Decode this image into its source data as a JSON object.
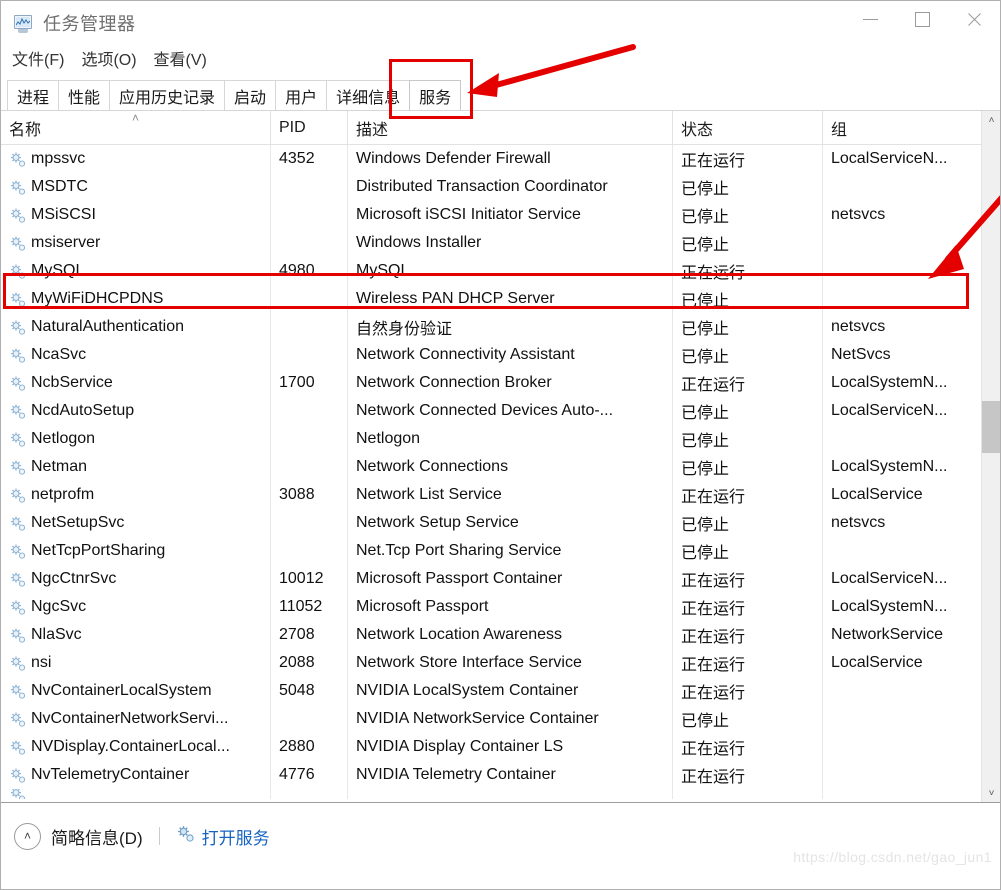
{
  "window": {
    "title": "任务管理器",
    "icon": "task-manager-icon",
    "controls": {
      "minimize": "—",
      "maximize": "□",
      "close": "✕"
    }
  },
  "menu": {
    "items": [
      {
        "label": "文件(F)"
      },
      {
        "label": "选项(O)"
      },
      {
        "label": "查看(V)"
      }
    ]
  },
  "tabs": {
    "items": [
      {
        "label": "进程",
        "active": false
      },
      {
        "label": "性能",
        "active": false
      },
      {
        "label": "应用历史记录",
        "active": false
      },
      {
        "label": "启动",
        "active": false
      },
      {
        "label": "用户",
        "active": false
      },
      {
        "label": "详细信息",
        "active": false
      },
      {
        "label": "服务",
        "active": true
      }
    ]
  },
  "table": {
    "columns": [
      {
        "key": "name",
        "label": "名称",
        "sorted": true,
        "sort_caret": "˄"
      },
      {
        "key": "pid",
        "label": "PID",
        "sorted": false
      },
      {
        "key": "desc",
        "label": "描述",
        "sorted": false
      },
      {
        "key": "status",
        "label": "状态",
        "sorted": false
      },
      {
        "key": "group",
        "label": "组",
        "sorted": false
      }
    ],
    "rows": [
      {
        "name": "mpssvc",
        "pid": "4352",
        "desc": "Windows Defender Firewall",
        "status": "正在运行",
        "group": "LocalServiceN..."
      },
      {
        "name": "MSDTC",
        "pid": "",
        "desc": "Distributed Transaction Coordinator",
        "status": "已停止",
        "group": ""
      },
      {
        "name": "MSiSCSI",
        "pid": "",
        "desc": "Microsoft iSCSI Initiator Service",
        "status": "已停止",
        "group": "netsvcs"
      },
      {
        "name": "msiserver",
        "pid": "",
        "desc": "Windows Installer",
        "status": "已停止",
        "group": ""
      },
      {
        "name": "MySQL",
        "pid": "4980",
        "desc": "MySQL",
        "status": "正在运行",
        "group": "",
        "highlighted": true
      },
      {
        "name": "MyWiFiDHCPDNS",
        "pid": "",
        "desc": "Wireless PAN DHCP Server",
        "status": "已停止",
        "group": ""
      },
      {
        "name": "NaturalAuthentication",
        "pid": "",
        "desc": "自然身份验证",
        "status": "已停止",
        "group": "netsvcs"
      },
      {
        "name": "NcaSvc",
        "pid": "",
        "desc": "Network Connectivity Assistant",
        "status": "已停止",
        "group": "NetSvcs"
      },
      {
        "name": "NcbService",
        "pid": "1700",
        "desc": "Network Connection Broker",
        "status": "正在运行",
        "group": "LocalSystemN..."
      },
      {
        "name": "NcdAutoSetup",
        "pid": "",
        "desc": "Network Connected Devices Auto-...",
        "status": "已停止",
        "group": "LocalServiceN..."
      },
      {
        "name": "Netlogon",
        "pid": "",
        "desc": "Netlogon",
        "status": "已停止",
        "group": ""
      },
      {
        "name": "Netman",
        "pid": "",
        "desc": "Network Connections",
        "status": "已停止",
        "group": "LocalSystemN..."
      },
      {
        "name": "netprofm",
        "pid": "3088",
        "desc": "Network List Service",
        "status": "正在运行",
        "group": "LocalService"
      },
      {
        "name": "NetSetupSvc",
        "pid": "",
        "desc": "Network Setup Service",
        "status": "已停止",
        "group": "netsvcs"
      },
      {
        "name": "NetTcpPortSharing",
        "pid": "",
        "desc": "Net.Tcp Port Sharing Service",
        "status": "已停止",
        "group": ""
      },
      {
        "name": "NgcCtnrSvc",
        "pid": "10012",
        "desc": "Microsoft Passport Container",
        "status": "正在运行",
        "group": "LocalServiceN..."
      },
      {
        "name": "NgcSvc",
        "pid": "11052",
        "desc": "Microsoft Passport",
        "status": "正在运行",
        "group": "LocalSystemN..."
      },
      {
        "name": "NlaSvc",
        "pid": "2708",
        "desc": "Network Location Awareness",
        "status": "正在运行",
        "group": "NetworkService"
      },
      {
        "name": "nsi",
        "pid": "2088",
        "desc": "Network Store Interface Service",
        "status": "正在运行",
        "group": "LocalService"
      },
      {
        "name": "NvContainerLocalSystem",
        "pid": "5048",
        "desc": "NVIDIA LocalSystem Container",
        "status": "正在运行",
        "group": ""
      },
      {
        "name": "NvContainerNetworkServi...",
        "pid": "",
        "desc": "NVIDIA NetworkService Container",
        "status": "已停止",
        "group": ""
      },
      {
        "name": "NVDisplay.ContainerLocal...",
        "pid": "2880",
        "desc": "NVIDIA Display Container LS",
        "status": "正在运行",
        "group": ""
      },
      {
        "name": "NvTelemetryContainer",
        "pid": "4776",
        "desc": "NVIDIA Telemetry Container",
        "status": "正在运行",
        "group": ""
      }
    ]
  },
  "scrollbar": {
    "up_arrow": "˄",
    "down_arrow": "˅"
  },
  "statusbar": {
    "collapse_icon": "˄",
    "fewer_details": "简略信息(D)",
    "open_services": "打开服务",
    "open_services_icon": "service-gear-icon"
  },
  "watermark": "https://blog.csdn.net/gao_jun1",
  "colors": {
    "annotation_red": "#e50000",
    "link_blue": "#1764c0",
    "title_gray": "#6f6f6f"
  }
}
